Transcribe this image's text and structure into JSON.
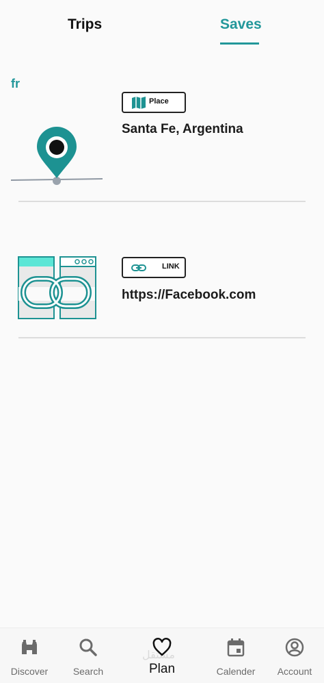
{
  "tabs": {
    "trips": "Trips",
    "saves": "Saves",
    "active": "Saves"
  },
  "language_label": "fr",
  "items": [
    {
      "type_label": "Place",
      "type_icon": "map-icon",
      "title": "Santa Fe, Argentina",
      "thumb_icon": "location-pin-icon"
    },
    {
      "type_label": "LINK",
      "type_icon": "link-icon",
      "title": "https://Facebook.com",
      "thumb_icon": "chain-link-illustration"
    }
  ],
  "bottom_nav": [
    {
      "label": "Discover",
      "icon": "binoculars-icon"
    },
    {
      "label": "Search",
      "icon": "search-icon"
    },
    {
      "label": "Plan",
      "icon": "heart-icon",
      "active": true
    },
    {
      "label": "Calender",
      "icon": "calendar-icon"
    },
    {
      "label": "Account",
      "icon": "account-icon"
    }
  ],
  "watermark": "مستقل",
  "colors": {
    "accent": "#22979a",
    "text": "#1a1a1a",
    "muted": "#6b6b6b",
    "divider": "#dcdcdc"
  }
}
